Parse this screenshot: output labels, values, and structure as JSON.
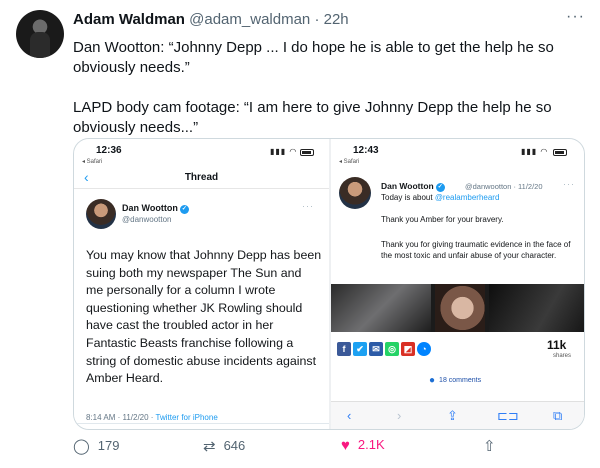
{
  "tweet": {
    "author_name": "Adam Waldman",
    "author_handle": "@adam_waldman",
    "time": "· 22h",
    "text": "Dan Wootton: “Johnny Depp ... I do hope he is able to get the help he so obviously needs.”\n\nLAPD body cam footage: “I am here to give Johnny Depp the help he so obviously needs...”",
    "more_icon": "more-icon",
    "actions": {
      "replies": "179",
      "retweets": "646",
      "likes": "2.1K",
      "liked": true,
      "accent_like": "#f91880"
    }
  },
  "left_screenshot": {
    "time": "12:36",
    "carrier": "◂ Safari",
    "header_title": "Thread",
    "profile_name": "Dan Wootton",
    "profile_handle": "@danwootton",
    "body": "You may know that Johnny Depp has been suing both my newspaper The Sun and me personally for a column I wrote questioning whether JK Rowling should have cast the troubled actor in her Fantastic Beasts franchise following a string of domestic abuse incidents against Amber Heard.",
    "date": "8:14 AM · 11/2/20 · ",
    "source": "Twitter for iPhone"
  },
  "right_screenshot": {
    "time": "12:43",
    "carrier": "◂ Safari",
    "profile_name": "Dan Wootton",
    "profile_meta": "@danwootton · 11/2/20",
    "reply_prefix": "Today is about ",
    "reply_at": "@realamberheard",
    "line1": "Thank you Amber for your bravery.",
    "line2": "Thank you for giving traumatic evidence in the face of the most toxic and unfair abuse of your character.",
    "share_count": "11k",
    "share_label": "shares",
    "comments": "18 comments",
    "share_icons": [
      "f",
      "✔",
      "✉",
      "◎",
      "◩",
      "◔"
    ],
    "share_colors": [
      "#3b5998",
      "#1da1f2",
      "#2c5ba7",
      "#25d366",
      "#d93025",
      "#0084ff"
    ]
  }
}
